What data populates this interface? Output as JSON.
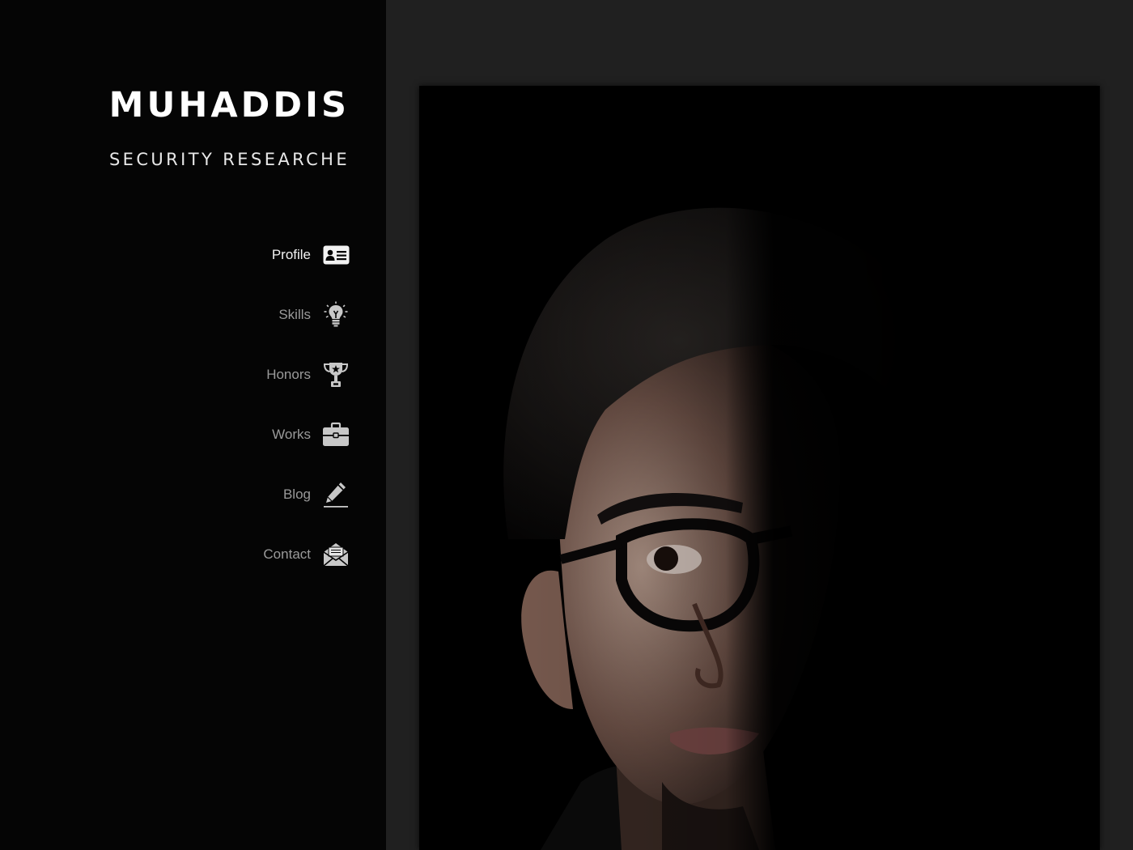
{
  "brand": {
    "name": "MUHADDIS",
    "subtitle": "SECURITY RESEARCHE"
  },
  "nav": {
    "items": [
      {
        "label": "Profile",
        "icon": "id-card-icon",
        "active": true
      },
      {
        "label": "Skills",
        "icon": "lightbulb-icon",
        "active": false
      },
      {
        "label": "Honors",
        "icon": "trophy-icon",
        "active": false
      },
      {
        "label": "Works",
        "icon": "briefcase-icon",
        "active": false
      },
      {
        "label": "Blog",
        "icon": "pencil-icon",
        "active": false
      },
      {
        "label": "Contact",
        "icon": "envelope-icon",
        "active": false
      }
    ]
  },
  "colors": {
    "sidebar_bg": "#050505",
    "content_bg": "#202020",
    "active_text": "#f2f2f2",
    "inactive_text": "#9a9a9a",
    "icon_color": "#c8c8c8"
  }
}
